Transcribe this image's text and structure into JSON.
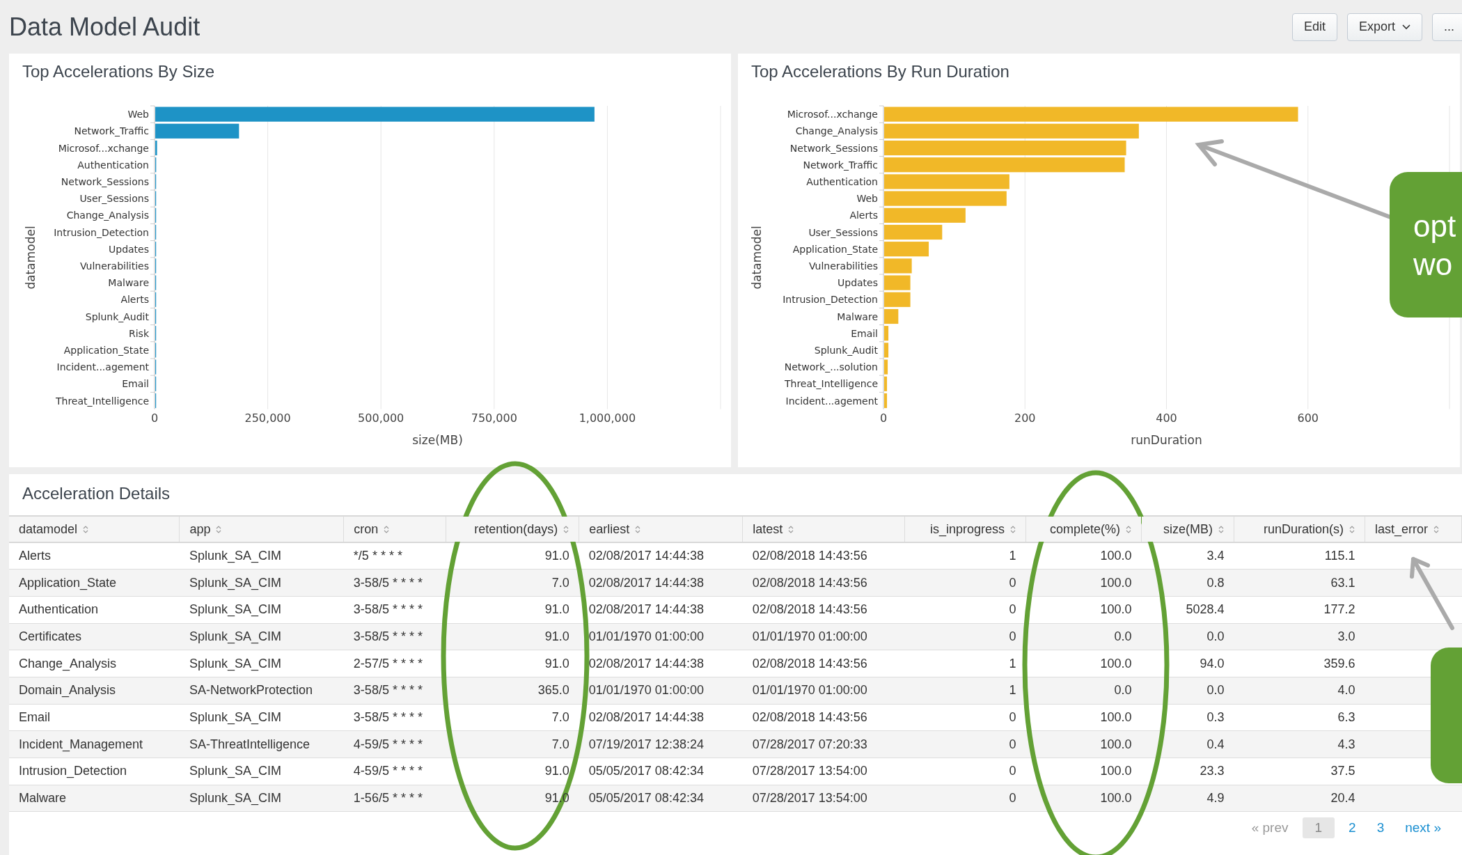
{
  "title": "Data Model Audit",
  "header_buttons": [
    {
      "label": "Edit",
      "kind": "plain"
    },
    {
      "label": "Export",
      "kind": "dropdown"
    },
    {
      "label": "...",
      "kind": "plain"
    }
  ],
  "charts": [
    {
      "title": "Top Accelerations By Size",
      "chart_data": {
        "type": "bar",
        "orientation": "horizontal",
        "grid": true,
        "xlabel": "size(MB)",
        "ylabel": "datamodel",
        "categories": [
          "Web",
          "Network_Traffic",
          "Microsof...xchange",
          "Authentication",
          "Network_Sessions",
          "User_Sessions",
          "Change_Analysis",
          "Intrusion_Detection",
          "Updates",
          "Vulnerabilities",
          "Malware",
          "Alerts",
          "Splunk_Audit",
          "Risk",
          "Application_State",
          "Incident...agement",
          "Email",
          "Threat_Intelligence"
        ],
        "series": [
          {
            "color": "#1e93c6",
            "values": [
              970000,
              185000,
              4000,
              2000,
              0,
              0,
              0,
              0,
              0,
              0,
              0,
              0,
              0,
              0,
              0,
              0,
              0,
              0
            ]
          }
        ],
        "xlim": [
          0,
          1250000
        ],
        "xticks": [
          {
            "value": 0,
            "label": "0"
          },
          {
            "value": 250000,
            "label": "250,000"
          },
          {
            "value": 500000,
            "label": "500,000"
          },
          {
            "value": 750000,
            "label": "750,000"
          },
          {
            "value": 1000000,
            "label": "1,000,000"
          }
        ]
      }
    },
    {
      "title": "Top Accelerations By Run Duration",
      "chart_data": {
        "type": "bar",
        "orientation": "horizontal",
        "grid": true,
        "xlabel": "runDuration",
        "ylabel": "datamodel",
        "categories": [
          "Microsof...xchange",
          "Change_Analysis",
          "Network_Sessions",
          "Network_Traffic",
          "Authentication",
          "Web",
          "Alerts",
          "User_Sessions",
          "Application_State",
          "Vulnerabilities",
          "Updates",
          "Intrusion_Detection",
          "Malware",
          "Email",
          "Splunk_Audit",
          "Network_...solution",
          "Threat_Intelligence",
          "Incident...agement"
        ],
        "series": [
          {
            "color": "#f1b828",
            "values": [
              585,
              360,
              342,
              340,
              177,
              173,
              115,
              82,
              63,
              39,
              37,
              37,
              20,
              6,
              6,
              5,
              4,
              4
            ]
          }
        ],
        "xlim": [
          0,
          800
        ],
        "xticks": [
          {
            "value": 0,
            "label": "0"
          },
          {
            "value": 200,
            "label": "200"
          },
          {
            "value": 400,
            "label": "400"
          },
          {
            "value": 600,
            "label": "600"
          }
        ]
      }
    }
  ],
  "table": {
    "title": "Acceleration Details",
    "columns": [
      {
        "label": "datamodel",
        "numeric": false
      },
      {
        "label": "app",
        "numeric": false
      },
      {
        "label": "cron",
        "numeric": false
      },
      {
        "label": "retention(days)",
        "numeric": true
      },
      {
        "label": "earliest",
        "numeric": false
      },
      {
        "label": "latest",
        "numeric": false
      },
      {
        "label": "is_inprogress",
        "numeric": true
      },
      {
        "label": "complete(%)",
        "numeric": true
      },
      {
        "label": "size(MB)",
        "numeric": true
      },
      {
        "label": "runDuration(s)",
        "numeric": true
      },
      {
        "label": "last_error",
        "numeric": false
      }
    ],
    "rows": [
      [
        "Alerts",
        "Splunk_SA_CIM",
        "*/5 * * * *",
        "91.0",
        "02/08/2017 14:44:38",
        "02/08/2018 14:43:56",
        "1",
        "100.0",
        "3.4",
        "115.1"
      ],
      [
        "Application_State",
        "Splunk_SA_CIM",
        "3-58/5 * * * *",
        "7.0",
        "02/08/2017 14:44:38",
        "02/08/2018 14:43:56",
        "0",
        "100.0",
        "0.8",
        "63.1"
      ],
      [
        "Authentication",
        "Splunk_SA_CIM",
        "3-58/5 * * * *",
        "91.0",
        "02/08/2017 14:44:38",
        "02/08/2018 14:43:56",
        "0",
        "100.0",
        "5028.4",
        "177.2"
      ],
      [
        "Certificates",
        "Splunk_SA_CIM",
        "3-58/5 * * * *",
        "91.0",
        "01/01/1970 01:00:00",
        "01/01/1970 01:00:00",
        "0",
        "0.0",
        "0.0",
        "3.0"
      ],
      [
        "Change_Analysis",
        "Splunk_SA_CIM",
        "2-57/5 * * * *",
        "91.0",
        "02/08/2017 14:44:38",
        "02/08/2018 14:43:56",
        "1",
        "100.0",
        "94.0",
        "359.6"
      ],
      [
        "Domain_Analysis",
        "SA-NetworkProtection",
        "3-58/5 * * * *",
        "365.0",
        "01/01/1970 01:00:00",
        "01/01/1970 01:00:00",
        "1",
        "0.0",
        "0.0",
        "4.0"
      ],
      [
        "Email",
        "Splunk_SA_CIM",
        "3-58/5 * * * *",
        "7.0",
        "02/08/2017 14:44:38",
        "02/08/2018 14:43:56",
        "0",
        "100.0",
        "0.3",
        "6.3"
      ],
      [
        "Incident_Management",
        "SA-ThreatIntelligence",
        "4-59/5 * * * *",
        "7.0",
        "07/19/2017 12:38:24",
        "07/28/2017 07:20:33",
        "0",
        "100.0",
        "0.4",
        "4.3"
      ],
      [
        "Intrusion_Detection",
        "Splunk_SA_CIM",
        "4-59/5 * * * *",
        "91.0",
        "05/05/2017 08:42:34",
        "07/28/2017 13:54:00",
        "0",
        "100.0",
        "23.3",
        "37.5"
      ],
      [
        "Malware",
        "Splunk_SA_CIM",
        "1-56/5 * * * *",
        "91.0",
        "05/05/2017 08:42:34",
        "07/28/2017 13:54:00",
        "0",
        "100.0",
        "4.9",
        "20.4"
      ]
    ]
  },
  "pagination": {
    "prev": {
      "label": "« prev",
      "disabled": true
    },
    "pages": [
      {
        "label": "1",
        "selected": true
      },
      {
        "label": "2",
        "selected": false
      },
      {
        "label": "3",
        "selected": false
      }
    ],
    "next": {
      "label": "next »",
      "disabled": false
    }
  },
  "callouts": [
    {
      "lines": [
        "opt",
        "wo"
      ]
    }
  ]
}
